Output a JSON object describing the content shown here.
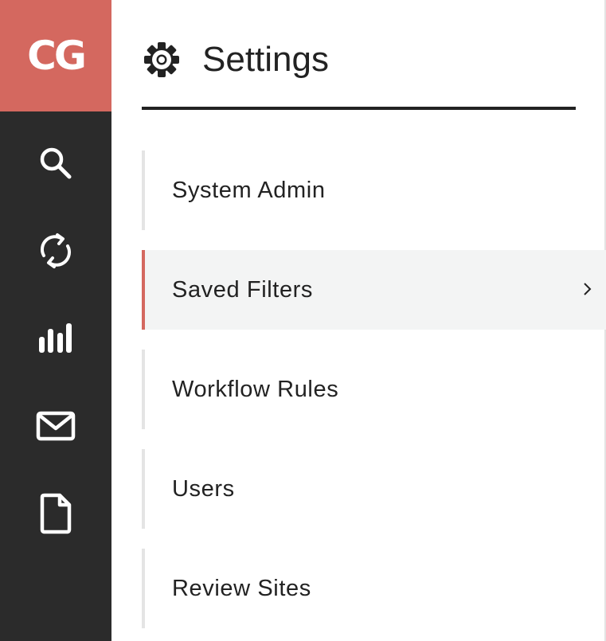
{
  "brand": {
    "logo_text": "CG",
    "color": "#d4685f"
  },
  "rail": {
    "background": "#2b2b2b",
    "icons": [
      "search-icon",
      "sync-icon",
      "bar-chart-icon",
      "mail-icon",
      "document-icon"
    ]
  },
  "header": {
    "icon": "gear-icon",
    "title": "Settings"
  },
  "menu": {
    "items": [
      {
        "label": "System Admin",
        "active": false
      },
      {
        "label": "Saved Filters",
        "active": true
      },
      {
        "label": "Workflow Rules",
        "active": false
      },
      {
        "label": "Users",
        "active": false
      },
      {
        "label": "Review Sites",
        "active": false
      }
    ],
    "active_indicator_color": "#d4685f"
  }
}
